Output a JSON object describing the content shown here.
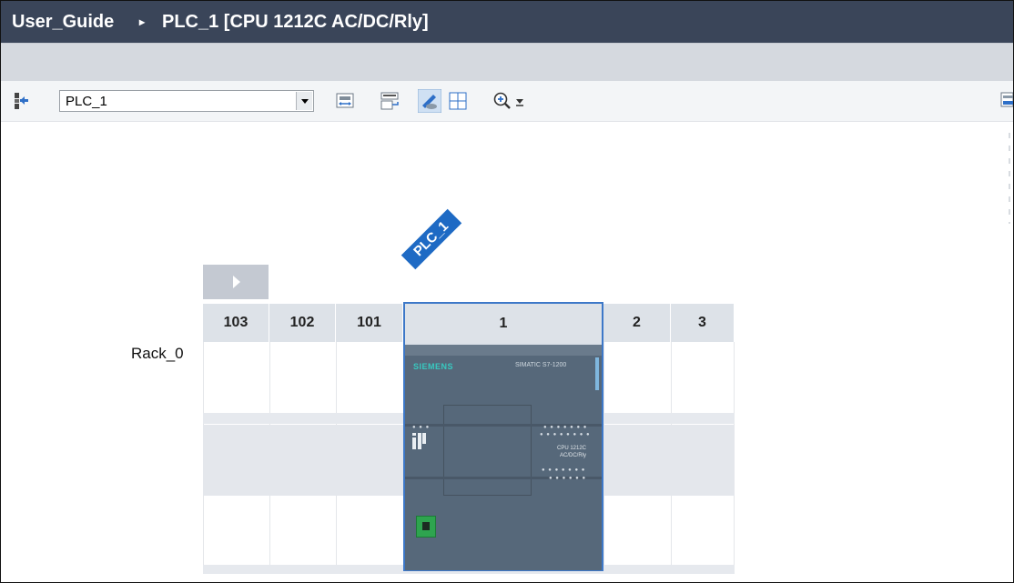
{
  "breadcrumb": {
    "project": "User_Guide",
    "separator": "▸",
    "device": "PLC_1 [CPU 1212C AC/DC/Rly]"
  },
  "toolbar": {
    "device_select_value": "PLC_1",
    "icons": [
      "network-view-icon",
      "device-overview-icon",
      "name-display-icon",
      "show-module-labels-icon",
      "page-break-icon",
      "zoom-in-icon",
      "zoom-options-icon"
    ],
    "right_icon": "hardware-catalog-icon"
  },
  "canvas": {
    "plc_tag": "PLC_1",
    "rack_label": "Rack_0",
    "slots": [
      "103",
      "102",
      "101",
      "1",
      "2",
      "3"
    ],
    "selected_slot": "1",
    "cpu_module": {
      "brand": "SIEMENS",
      "series": "SIMATIC S7-1200",
      "name_line1": "CPU 1212C",
      "name_line2": "AC/DC/Rly"
    }
  },
  "colors": {
    "titlebar": "#3a4559",
    "selection": "#3d78c8",
    "plc_tag": "#1e6ac4",
    "module_body": "#56687a",
    "brand_text": "#38c9c0"
  }
}
